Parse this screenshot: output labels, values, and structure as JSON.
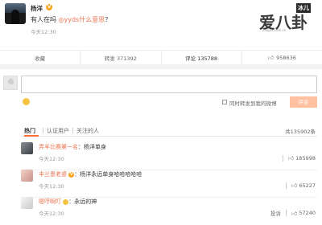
{
  "post": {
    "author": "杨洋",
    "verified_badge": "V",
    "text_before": "有人在吗 ",
    "text_highlight": "yyds什么意思",
    "text_after": "？",
    "time": "今天12:30"
  },
  "watermark": {
    "big": "爱八卦",
    "small": "冰儿",
    "url": "ibagua.com.cn"
  },
  "actions": {
    "favorite": "收藏",
    "repost": "转发 371392",
    "comment": "评论 135788",
    "like_count": "958636"
  },
  "composer": {
    "sync_label": "同时转发到我的微博",
    "submit_label": "评论"
  },
  "tabs": {
    "items": [
      "热门",
      "认证用户",
      "关注的人"
    ],
    "total": "共135902条"
  },
  "comments": [
    {
      "name": "弄羊比赛第一名",
      "badge": "",
      "text": "：杨洋单身",
      "time": "今天12:30",
      "reply": "",
      "likes": "185998"
    },
    {
      "name": "丰兰恩老婆",
      "badge": "V",
      "text": "：杨洋永远单身哈哈哈哈哈",
      "time": "今天12:30",
      "reply": "",
      "likes": "65227"
    },
    {
      "name": "嗯哼啊叮",
      "badge": "",
      "text": "：永远的神",
      "time": "今天12:30",
      "reply": "投诉",
      "likes": "57240"
    }
  ],
  "colors": {
    "accent": "#eb7350",
    "verified": "#f7a31c",
    "submit_disabled": "#ffc09f",
    "tab_underline": "#f86e2f"
  }
}
